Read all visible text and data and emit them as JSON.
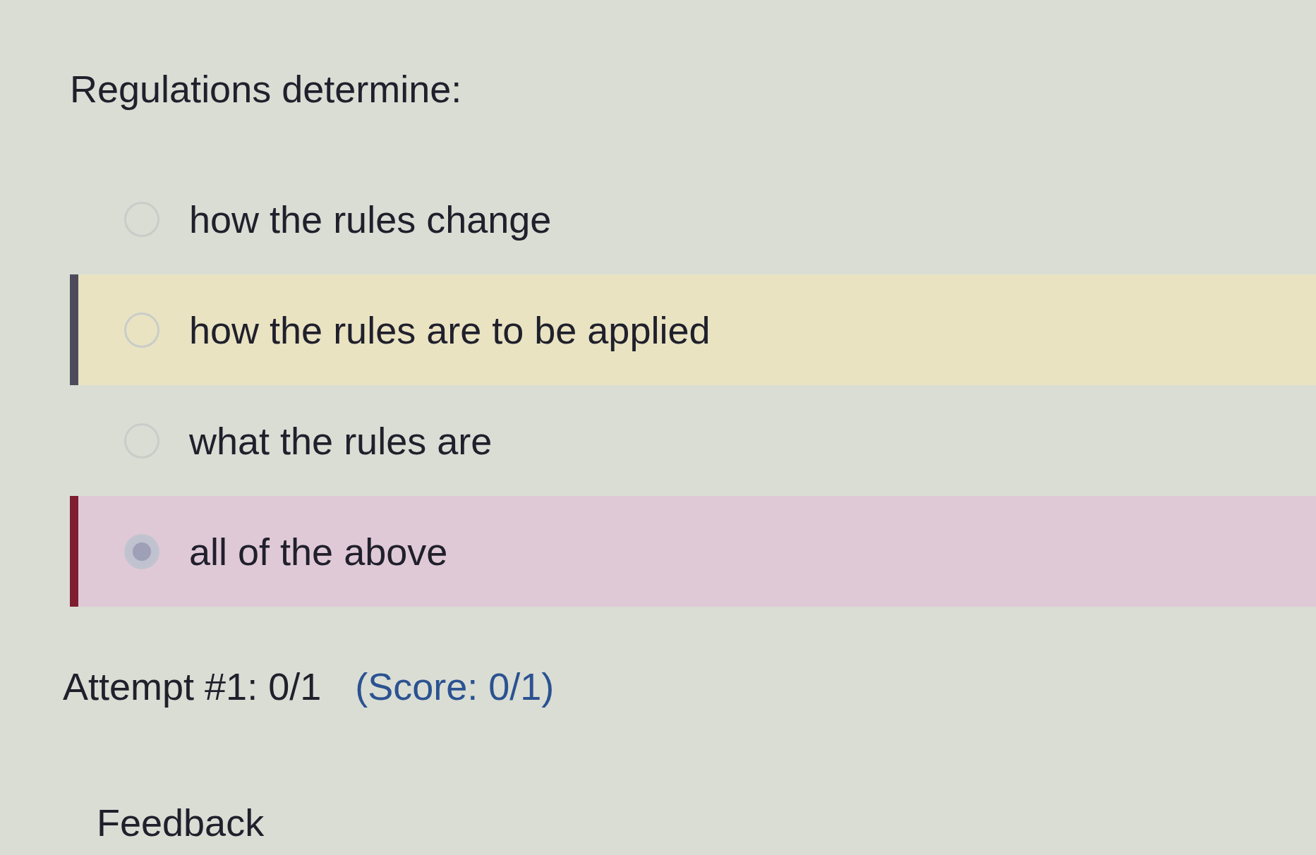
{
  "question": {
    "prompt": "Regulations determine:"
  },
  "options": [
    {
      "label": "how the rules change",
      "selected": false,
      "highlighted": false,
      "incorrect": false
    },
    {
      "label": "how the rules are to be applied",
      "selected": false,
      "highlighted": true,
      "incorrect": false
    },
    {
      "label": "what the rules are",
      "selected": false,
      "highlighted": false,
      "incorrect": false
    },
    {
      "label": "all of the above",
      "selected": true,
      "highlighted": false,
      "incorrect": true
    }
  ],
  "result": {
    "attempt": "Attempt #1: 0/1",
    "score": "(Score: 0/1)"
  },
  "feedback": {
    "heading": "Feedback"
  }
}
